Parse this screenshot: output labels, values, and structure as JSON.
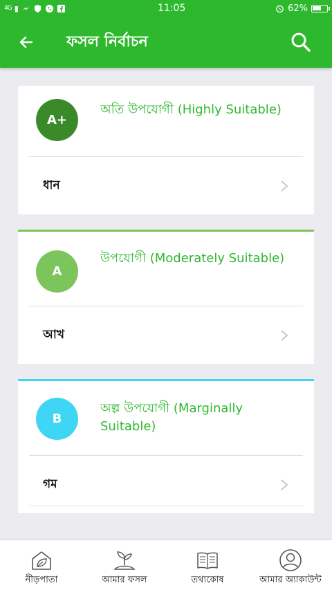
{
  "status_bar": {
    "network": "4G",
    "time": "11:05",
    "battery_text": "62%",
    "battery_level": 0.62
  },
  "app_bar": {
    "title": "ফসল নির্বাচন"
  },
  "colors": {
    "primary": "#2eb82e",
    "grade_a_plus": "#3a8a2a",
    "grade_a": "#7cc45c",
    "grade_b": "#3fd6f5"
  },
  "cards": [
    {
      "grade": "A+",
      "title": "অতি উপযোগী (Highly Suitable)",
      "crop": "ধান",
      "color": "#3a8a2a",
      "accent": ""
    },
    {
      "grade": "A",
      "title": "উপযোগী (Moderately Suitable)",
      "crop": "আখ",
      "color": "#7cc45c",
      "accent": "#7cc45c"
    },
    {
      "grade": "B",
      "title": "অল্প উপযোগী (Marginally Suitable)",
      "crop": "গম",
      "color": "#3fd6f5",
      "accent": "#3fd6f5"
    }
  ],
  "bottom_nav": [
    {
      "label": "নীড়পাতা",
      "icon": "home-leaf-icon"
    },
    {
      "label": "আমার ফসল",
      "icon": "sprout-icon"
    },
    {
      "label": "তথ্যকোষ",
      "icon": "book-icon"
    },
    {
      "label": "আমার অ্যাকাউন্ট",
      "icon": "account-icon"
    }
  ]
}
